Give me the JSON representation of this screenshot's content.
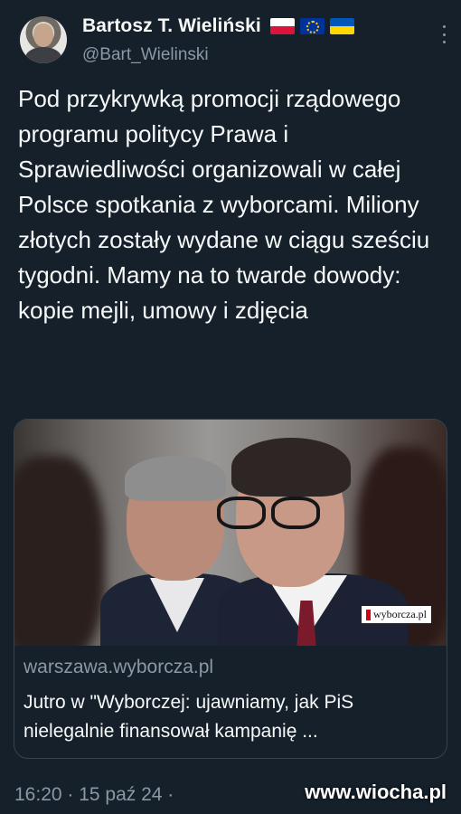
{
  "author": {
    "display_name": "Bartosz T. Wieliński",
    "handle": "@Bart_Wielinski",
    "flags": [
      "poland-flag-icon",
      "eu-flag-icon",
      "ukraine-flag-icon"
    ]
  },
  "tweet": {
    "text": "Pod przykrywką promocji rządowego programu politycy Prawa i Sprawiedliwości organizowali w całej Polsce spotkania z wyborcami. Miliony złotych zostały wydane w ciągu sześciu tygodni. Mamy na to twarde dowody: kopie mejli, umowy i zdjęcia",
    "timestamp": "16:20 · 15 paź 24 ·"
  },
  "card": {
    "image_watermark": "wyborcza.pl",
    "domain": "warszawa.wyborcza.pl",
    "title": "Jutro w \"Wyborczej: ujawniamy, jak PiS nielegalnie finansował kampanię ..."
  },
  "site_watermark": "www.wiocha.pl",
  "colors": {
    "background": "#15202b",
    "text_primary": "#f7f9f9",
    "text_secondary": "#8b98a5",
    "border": "#38444d"
  }
}
